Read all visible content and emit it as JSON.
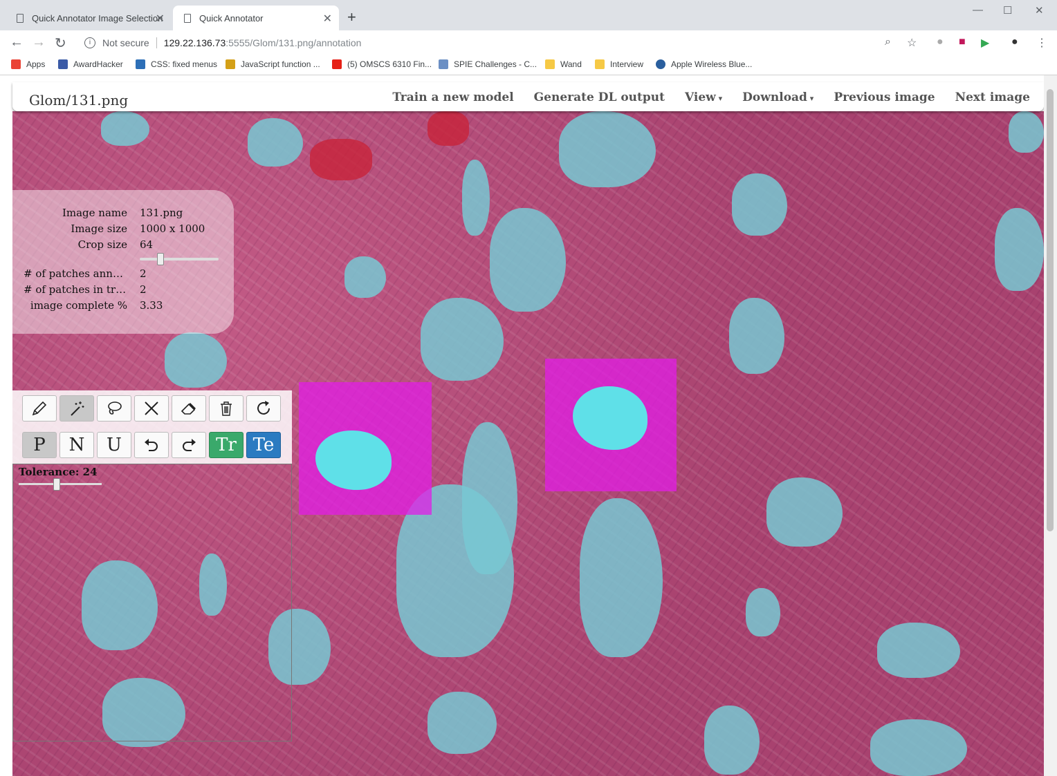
{
  "browser": {
    "tabs": [
      {
        "title": "Quick Annotator Image Selection",
        "active": false
      },
      {
        "title": "Quick Annotator",
        "active": true
      }
    ],
    "security_label": "Not secure",
    "url_host": "129.22.136.73",
    "url_rest": ":5555/Glom/131.png/annotation",
    "bookmarks": [
      {
        "label": "Apps",
        "color": "#ea4335"
      },
      {
        "label": "AwardHacker",
        "color": "#3b5ba7"
      },
      {
        "label": "CSS: fixed menus",
        "color": "#2d6fb7"
      },
      {
        "label": "JavaScript function ...",
        "color": "#d4a017"
      },
      {
        "label": "(5) OMSCS 6310 Fin...",
        "color": "#e62117"
      },
      {
        "label": "SPIE Challenges - C...",
        "color": "#6b8fc4"
      },
      {
        "label": "Wand",
        "color": "#f6c945"
      },
      {
        "label": "Interview",
        "color": "#f6c945"
      },
      {
        "label": "Apple Wireless Blue...",
        "color": "#2a5f9e"
      }
    ]
  },
  "app": {
    "brand": "Glom/131.png",
    "nav": {
      "train": "Train a new model",
      "generate": "Generate DL output",
      "view": "View",
      "download": "Download",
      "previous": "Previous image",
      "next": "Next image"
    },
    "info": [
      {
        "key": "Image name",
        "value": "131.png"
      },
      {
        "key": "Image size",
        "value": "1000 x 1000"
      },
      {
        "key": "Crop size",
        "value": "64"
      },
      {
        "key": "# of patches annotated",
        "value": "2"
      },
      {
        "key": "# of patches in training",
        "value": "2"
      },
      {
        "key": "image complete %",
        "value": "3.33"
      }
    ],
    "crop_slider_fraction": 0.25,
    "tools_row1": [
      "pencil-icon",
      "magic-wand-icon",
      "lasso-icon",
      "x-icon",
      "eraser-icon",
      "trash-icon",
      "refresh-icon"
    ],
    "tools_row2": {
      "positive": "P",
      "negative": "N",
      "unknown": "U",
      "train": "Tr",
      "test": "Te"
    },
    "tolerance_label": "Tolerance: 24",
    "tolerance_fraction": 0.45
  }
}
